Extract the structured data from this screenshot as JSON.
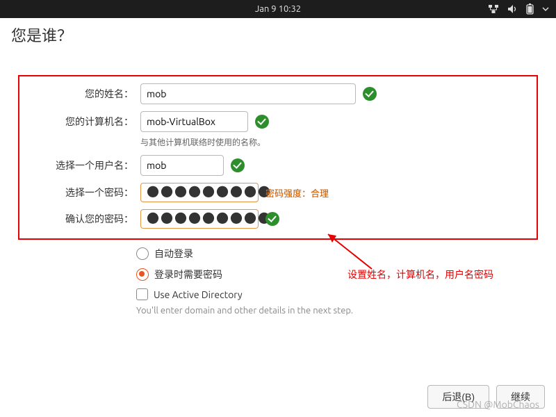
{
  "topbar": {
    "datetime": "Jan 9  10:32"
  },
  "heading": "您是谁？",
  "form": {
    "name_label": "您的姓名：",
    "name_value": "mob",
    "computer_label": "您的计算机名：",
    "computer_value": "mob-VirtualBox",
    "computer_hint": "与其他计算机联络时使用的名称。",
    "user_label": "选择一个用户名：",
    "user_value": "mob",
    "pw_label": "选择一个密码：",
    "pw_value": "●●●●●●●●●",
    "pw_strength": "密码强度：合理",
    "confirm_label": "确认您的密码：",
    "confirm_value": "●●●●●●●●●",
    "auto_login": "自动登录",
    "require_pw": "登录时需要密码",
    "ad_label": "Use Active Directory",
    "ad_hint": "You'll enter domain and other details in the next step."
  },
  "annotation": "设置姓名，计算机名，用户名密码",
  "footer": {
    "back": "后退(B)",
    "continue": "继续"
  },
  "watermark": "CSDN @MobChaos"
}
